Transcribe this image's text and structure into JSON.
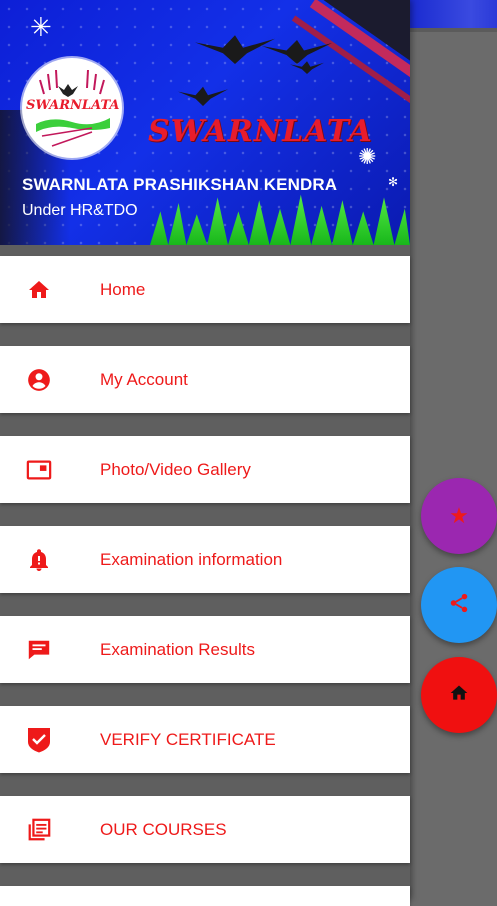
{
  "header": {
    "logo_text": "SWARNLATA",
    "brand_script": "SWARNLATA",
    "title": "SWARNLATA PRASHIKSHAN KENDRA",
    "subtitle": "Under HR&TDO"
  },
  "menu": {
    "items": [
      {
        "label": "Home",
        "icon": "home-icon"
      },
      {
        "label": "My Account",
        "icon": "account-circle-icon"
      },
      {
        "label": "Photo/Video Gallery",
        "icon": "gallery-icon"
      },
      {
        "label": "Examination information",
        "icon": "bell-alert-icon"
      },
      {
        "label": "Examination Results",
        "icon": "message-icon"
      },
      {
        "label": "VERIFY CERTIFICATE",
        "icon": "verified-shield-icon"
      },
      {
        "label": "OUR COURSES",
        "icon": "library-books-icon"
      }
    ]
  },
  "fabs": [
    {
      "name": "star",
      "icon": "star-icon",
      "color": "#9b27b0"
    },
    {
      "name": "share",
      "icon": "share-icon",
      "color": "#2196f3"
    },
    {
      "name": "home",
      "icon": "home-icon",
      "color": "#f01010"
    }
  ],
  "colors": {
    "accent_red": "#ee1a1a",
    "header_blue": "#1330e8",
    "fab_purple": "#9b27b0",
    "fab_blue": "#2196f3",
    "fab_red": "#f01010"
  }
}
